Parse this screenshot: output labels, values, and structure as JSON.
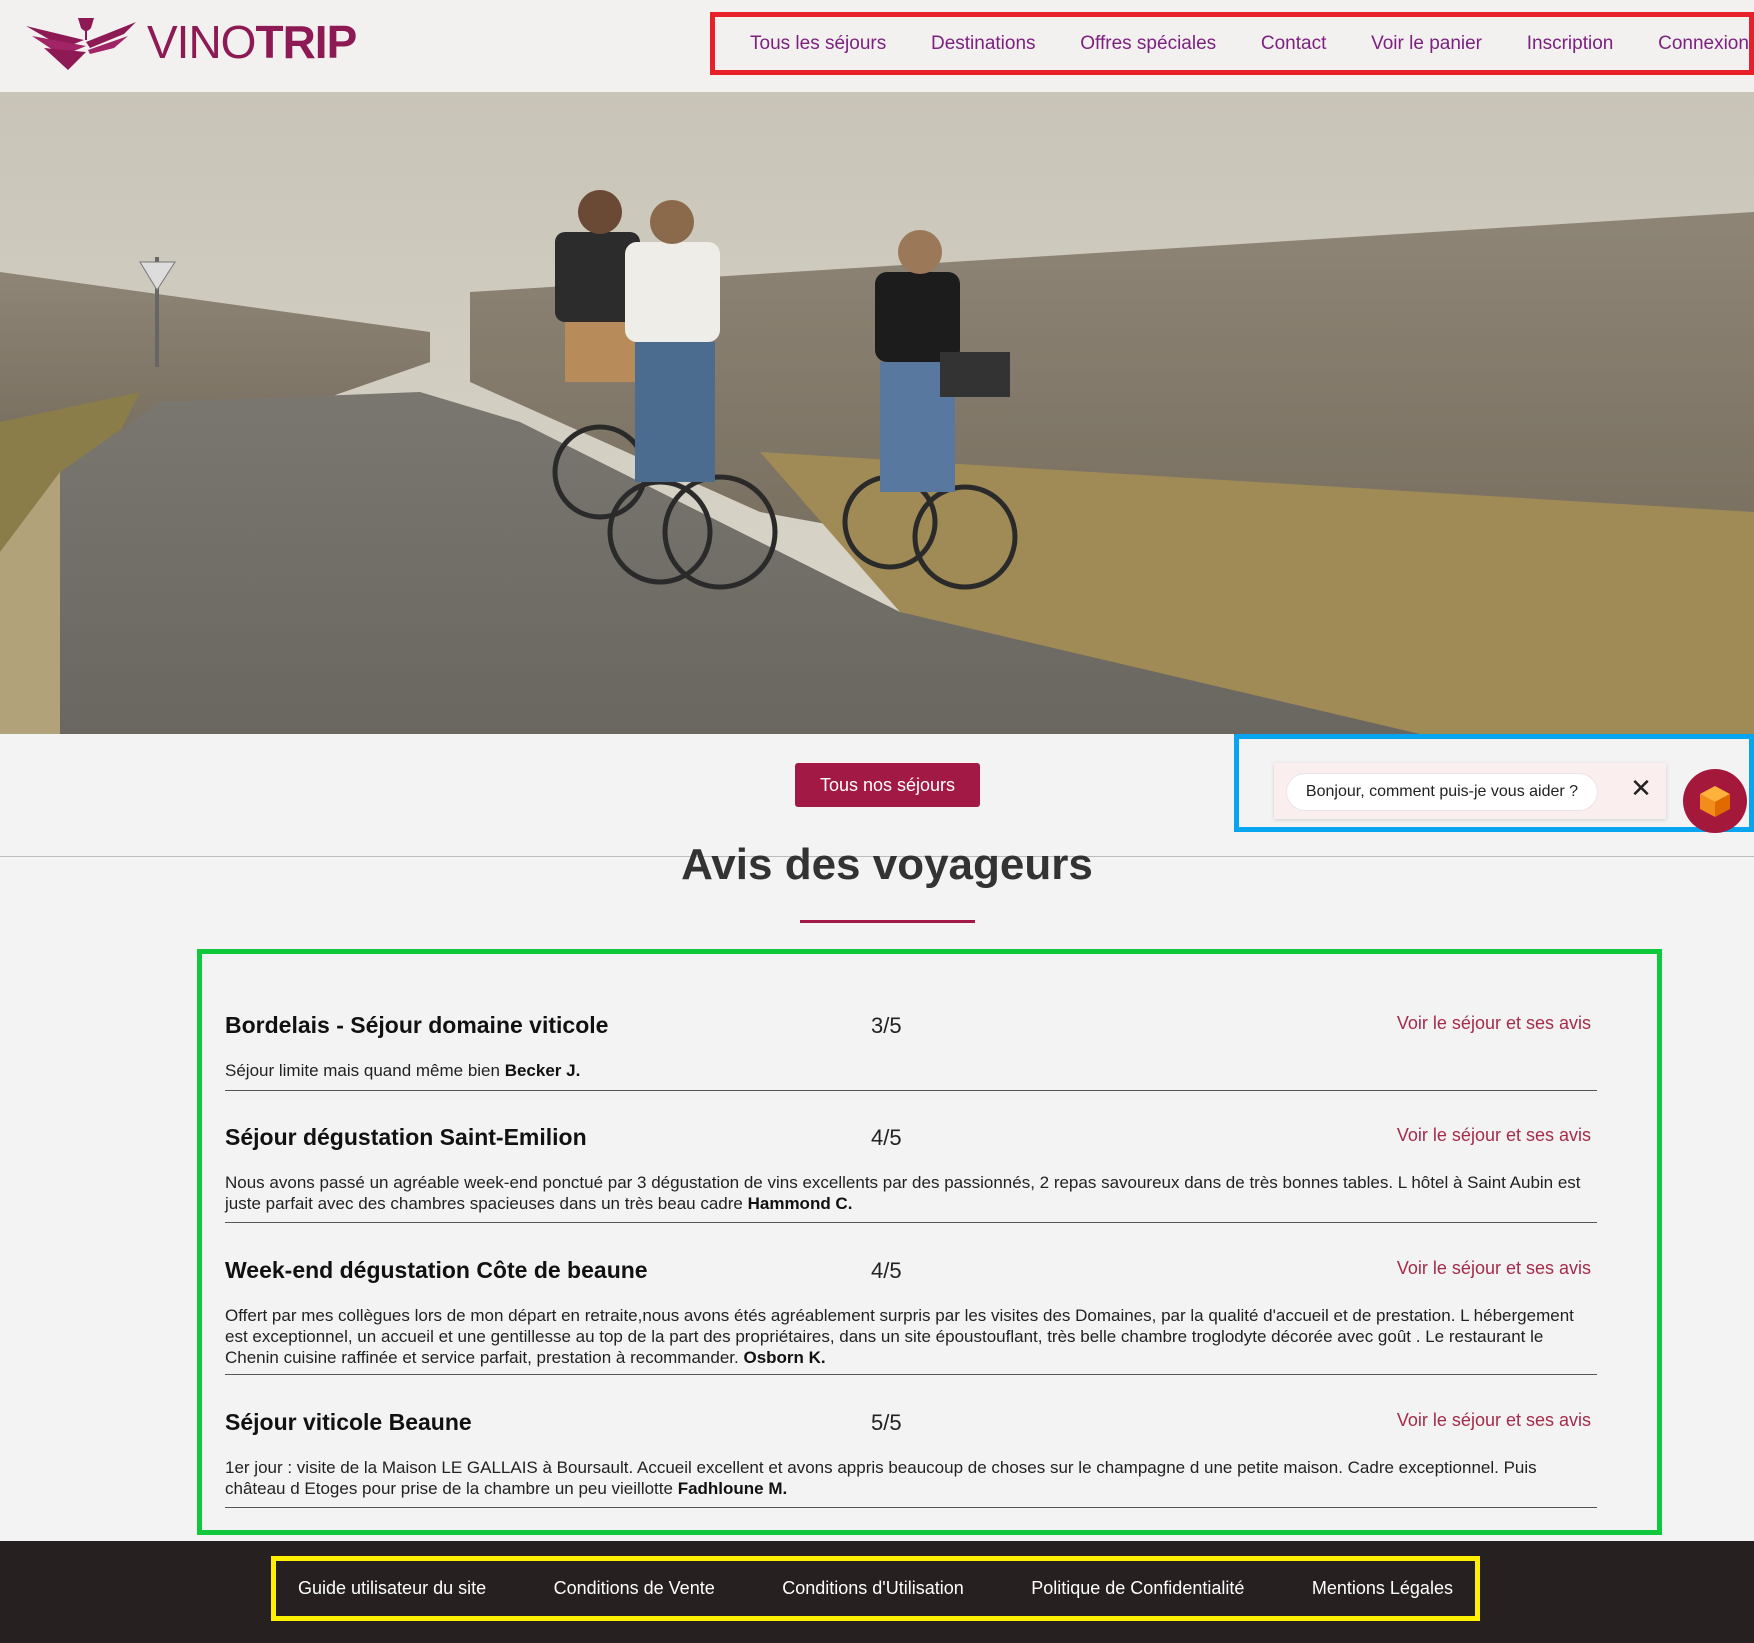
{
  "brand": {
    "name_light": "VINO",
    "name_bold": "TRIP",
    "color": "#8e1a55"
  },
  "nav": {
    "items": [
      {
        "label": "Tous les séjours"
      },
      {
        "label": "Destinations"
      },
      {
        "label": "Offres spéciales"
      },
      {
        "label": "Contact"
      },
      {
        "label": "Voir le panier"
      },
      {
        "label": "Inscription"
      },
      {
        "label": "Connexion"
      }
    ]
  },
  "hero": {
    "image": "cyclists-riding-on-country-road-photo"
  },
  "cta": {
    "label": "Tous nos séjours",
    "color": "#a11944"
  },
  "chat": {
    "message": "Bonjour, comment puis-je vous aider ?",
    "close_icon": "close-icon",
    "avatar_icon": "cube-icon"
  },
  "reviews": {
    "title": "Avis des voyageurs",
    "link_label": "Voir le séjour et ses avis",
    "items": [
      {
        "title": "Bordelais - Séjour domaine viticole",
        "score": "3/5",
        "text": "Séjour limite mais quand même bien",
        "author": "Becker J."
      },
      {
        "title": "Séjour dégustation Saint-Emilion",
        "score": "4/5",
        "text": "Nous avons passé un agréable week-end ponctué par 3 dégustation de vins excellents par des passionnés, 2 repas savoureux dans de très bonnes tables. L hôtel à Saint Aubin est juste parfait avec des chambres spacieuses dans un très beau cadre",
        "author": "Hammond C."
      },
      {
        "title": "Week-end dégustation Côte de beaune",
        "score": "4/5",
        "text": "Offert par mes collègues lors de mon départ en retraite,nous avons étés agréablement surpris par les visites des Domaines, par la qualité d'accueil et de prestation. L hébergement est exceptionnel, un accueil et une gentillesse au top de la part des propriétaires, dans un site époustouflant, très belle chambre troglodyte décorée avec goût . Le restaurant le Chenin cuisine raffinée et service parfait, prestation à recommander.",
        "author": "Osborn K."
      },
      {
        "title": "Séjour viticole Beaune",
        "score": "5/5",
        "text": "1er jour : visite de la Maison LE GALLAIS à Boursault. Accueil excellent et avons appris beaucoup de choses sur le champagne d une petite maison. Cadre exceptionnel. Puis château d Etoges pour prise de la chambre un peu vieillotte",
        "author": "Fadhloune M."
      }
    ]
  },
  "footer": {
    "links": [
      {
        "label": "Guide utilisateur du site"
      },
      {
        "label": "Conditions de Vente"
      },
      {
        "label": "Conditions d'Utilisation"
      },
      {
        "label": "Politique de Confidentialité"
      },
      {
        "label": "Mentions Légales"
      }
    ]
  }
}
